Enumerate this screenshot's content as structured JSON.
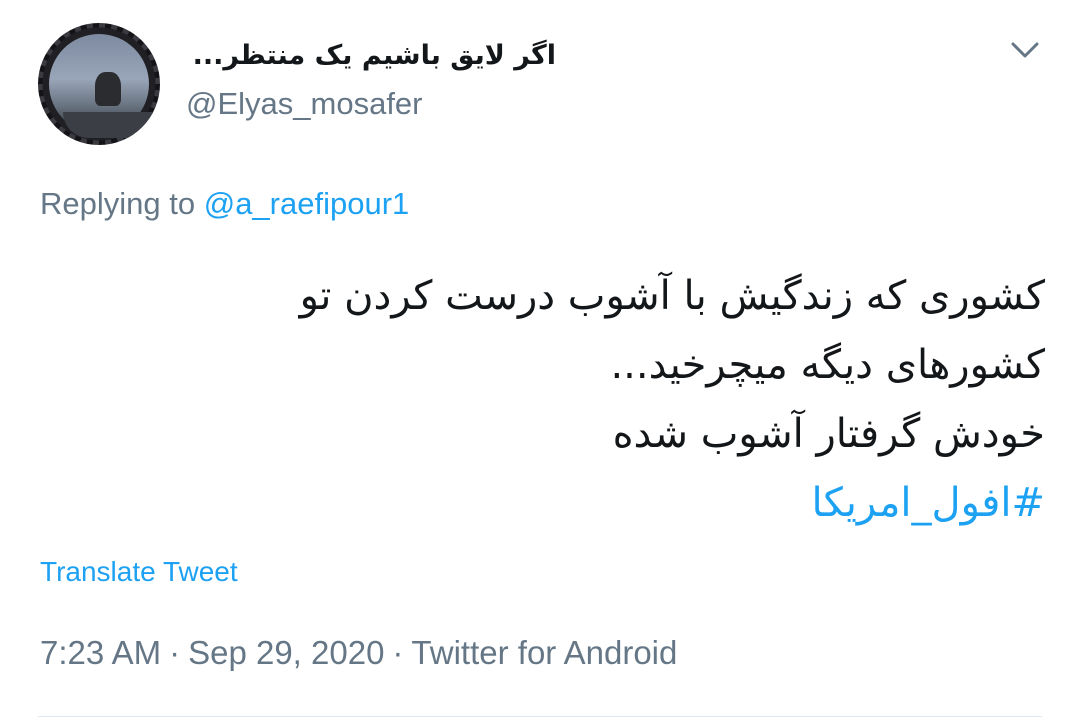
{
  "user": {
    "display_name": "اگر لایق باشیم یک منتظر...",
    "handle": "@Elyas_mosafer"
  },
  "reply": {
    "prefix": "Replying to",
    "mention": "@a_raefipour1"
  },
  "tweet": {
    "lines": [
      "کشوری که زندگیش با آشوب درست کردن تو",
      "کشورهای دیگه میچرخید...",
      "خودش گرفتار آشوب شده"
    ],
    "hashtag": "#افول_امریکا"
  },
  "translate_label": "Translate Tweet",
  "meta": {
    "time": "7:23 AM",
    "separator": "·",
    "date": "Sep 29, 2020",
    "source": "Twitter for Android"
  },
  "icons": {
    "menu": "chevron-down-icon",
    "avatar": "profile-photo"
  },
  "colors": {
    "text": "#14171a",
    "secondary": "#657786",
    "link": "#1da1f2",
    "divider": "#e1e8ed"
  }
}
